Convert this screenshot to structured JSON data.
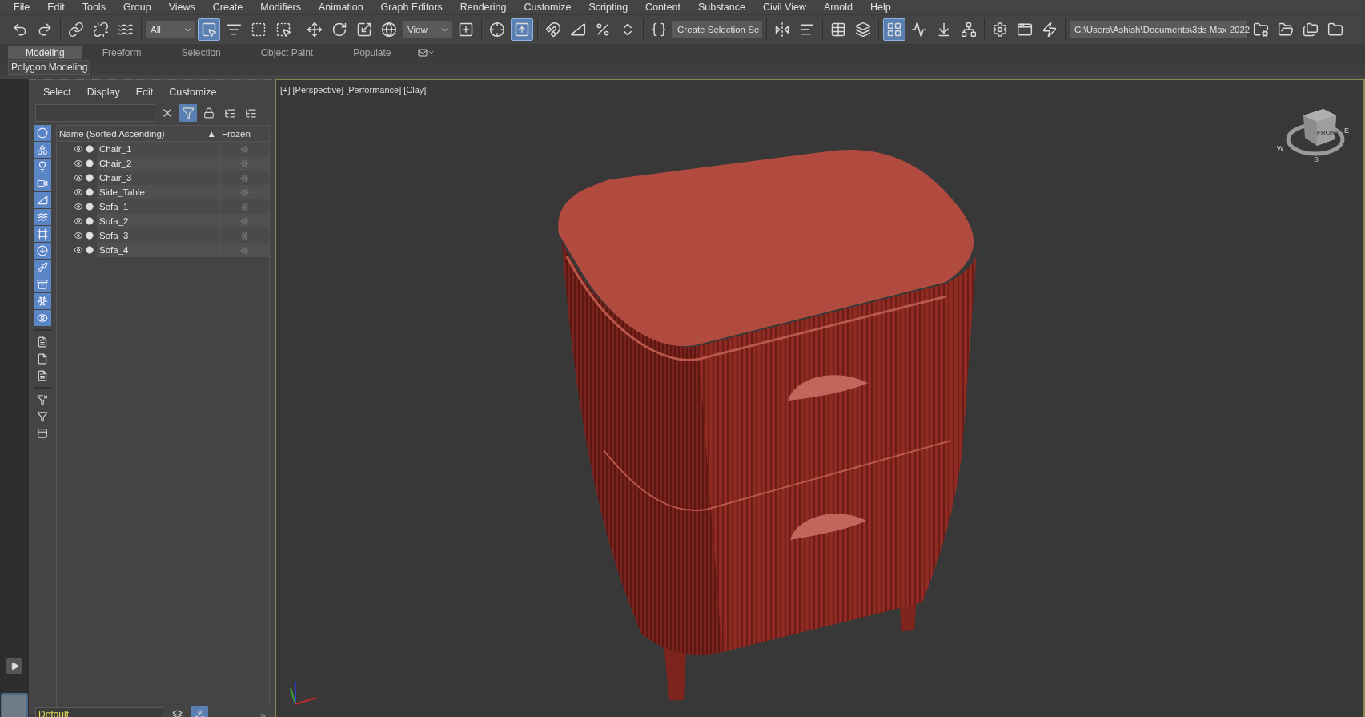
{
  "menu_bar": [
    "File",
    "Edit",
    "Tools",
    "Group",
    "Views",
    "Create",
    "Modifiers",
    "Animation",
    "Graph Editors",
    "Rendering",
    "Customize",
    "Scripting",
    "Content",
    "Substance",
    "Civil View",
    "Arnold",
    "Help"
  ],
  "toolbar": {
    "groups": [
      [
        {
          "kind": "button",
          "selected": false
        },
        {
          "kind": "button",
          "selected": false
        }
      ],
      [
        {
          "kind": "button",
          "selected": false
        },
        {
          "kind": "button",
          "selected": false
        },
        {
          "kind": "button",
          "selected": false
        }
      ],
      [
        {
          "kind": "dropdown",
          "value": "All"
        },
        {
          "kind": "button",
          "selected": true
        },
        {
          "kind": "button",
          "selected": false
        },
        {
          "kind": "button",
          "selected": false
        },
        {
          "kind": "button",
          "selected": false
        }
      ],
      [
        {
          "kind": "button",
          "selected": false
        },
        {
          "kind": "button",
          "selected": false
        },
        {
          "kind": "button",
          "selected": false
        },
        {
          "kind": "button",
          "selected": false
        },
        {
          "kind": "dropdown",
          "value": "View"
        },
        {
          "kind": "button",
          "selected": false
        }
      ],
      [
        {
          "kind": "button",
          "selected": false
        },
        {
          "kind": "button",
          "selected": true
        }
      ],
      [
        {
          "kind": "button",
          "selected": false
        },
        {
          "kind": "button",
          "selected": false
        },
        {
          "kind": "button",
          "selected": false
        },
        {
          "kind": "button",
          "selected": false
        }
      ],
      [
        {
          "kind": "button",
          "selected": false
        },
        {
          "kind": "dropdown",
          "value": "Create Selection Se"
        }
      ],
      [
        {
          "kind": "button",
          "selected": false
        },
        {
          "kind": "button",
          "selected": false
        }
      ],
      [
        {
          "kind": "button",
          "selected": false
        },
        {
          "kind": "button",
          "selected": false
        }
      ],
      [
        {
          "kind": "button",
          "selected": true
        },
        {
          "kind": "button",
          "selected": false
        },
        {
          "kind": "button",
          "selected": false
        },
        {
          "kind": "button",
          "selected": false
        }
      ],
      [
        {
          "kind": "button",
          "selected": false
        },
        {
          "kind": "button",
          "selected": false
        },
        {
          "kind": "button",
          "selected": false
        }
      ],
      [
        {
          "kind": "dropdown",
          "value": "C:\\Users\\Ashish\\Documents\\3ds Max 2022"
        },
        {
          "kind": "button",
          "selected": false
        },
        {
          "kind": "button",
          "selected": false
        },
        {
          "kind": "button",
          "selected": false
        },
        {
          "kind": "button",
          "selected": false
        }
      ]
    ]
  },
  "ribbon": {
    "tabs": [
      {
        "label": "Modeling",
        "selected": true
      },
      {
        "label": "Freeform",
        "selected": false
      },
      {
        "label": "Selection",
        "selected": false
      },
      {
        "label": "Object Paint",
        "selected": false
      },
      {
        "label": "Populate",
        "selected": false
      }
    ],
    "panel": "Polygon Modeling"
  },
  "scene_explorer": {
    "menus": [
      "Select",
      "Display",
      "Edit",
      "Customize"
    ],
    "filter_selected": true,
    "filters": [
      {
        "selected": true
      },
      {
        "selected": true
      },
      {
        "selected": true
      },
      {
        "selected": true
      },
      {
        "selected": true
      },
      {
        "selected": true
      },
      {
        "selected": true
      },
      {
        "selected": true
      },
      {
        "selected": true
      },
      {
        "selected": true
      },
      {
        "selected": true
      },
      {
        "selected": true
      },
      {
        "selected": false
      },
      {
        "selected": false
      },
      {
        "selected": false
      },
      {
        "selected": false
      },
      {
        "selected": false
      },
      {
        "selected": false
      }
    ],
    "columns": [
      "Name (Sorted Ascending)",
      "Frozen"
    ],
    "sort_mark": "▲",
    "rows": [
      {
        "name": "Chair_1"
      },
      {
        "name": "Chair_2"
      },
      {
        "name": "Chair_3"
      },
      {
        "name": "Side_Table"
      },
      {
        "name": "Sofa_1"
      },
      {
        "name": "Sofa_2"
      },
      {
        "name": "Sofa_3"
      },
      {
        "name": "Sofa_4"
      }
    ],
    "layer": "Default",
    "bottom_buttons": [
      {
        "selected": false
      },
      {
        "selected": true
      }
    ],
    "more": "»"
  },
  "viewport": {
    "labels": [
      "[+]",
      "[Perspective]",
      "[Performance]",
      "[Clay]"
    ],
    "viewcube": {
      "front": "FRONT",
      "compass": [
        "W",
        "E",
        "S"
      ]
    }
  }
}
